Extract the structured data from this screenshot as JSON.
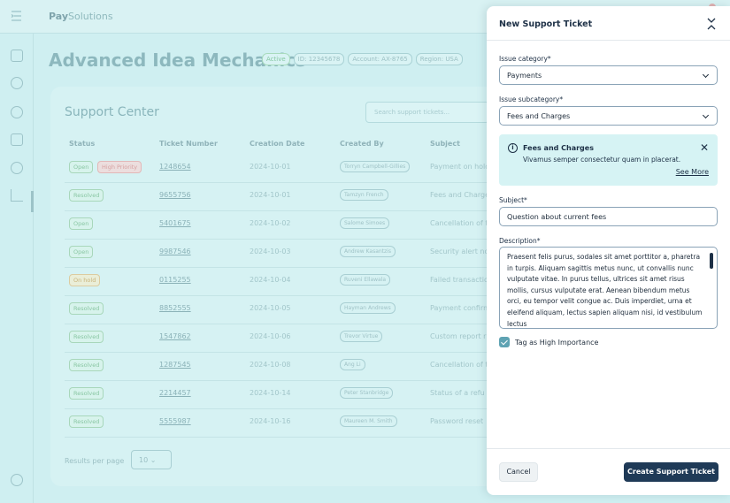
{
  "app": {
    "brand_bold": "Pay",
    "brand_rest": "Solutions",
    "org_title": "Advanced Idea Mechanics",
    "tags": [
      "Active",
      "ID: 12345678",
      "Account: AX-8765",
      "Region: USA"
    ]
  },
  "support": {
    "title": "Support Center",
    "search_placeholder": "Search support tickets...",
    "columns": [
      "Status",
      "Ticket Number",
      "Creation Date",
      "Created By",
      "Subject"
    ],
    "rows": [
      {
        "status": "Open",
        "priority": "High Priority",
        "ticket": "1248654",
        "date": "2024-10-01",
        "by": "Torryn Campbell-Gillies",
        "subject": "Payment on hold"
      },
      {
        "status": "Resolved",
        "priority": "",
        "ticket": "9655756",
        "date": "2024-10-01",
        "by": "Tamzyn French",
        "subject": "Fees and Charges"
      },
      {
        "status": "Open",
        "priority": "",
        "ticket": "5401675",
        "date": "2024-10-02",
        "by": "Salome Simoes",
        "subject": "Cancellation of t"
      },
      {
        "status": "Open",
        "priority": "",
        "ticket": "9987546",
        "date": "2024-10-03",
        "by": "Andrew Kasantzis",
        "subject": "Security alert no"
      },
      {
        "status": "On hold",
        "priority": "",
        "ticket": "0115255",
        "date": "2024-10-04",
        "by": "Ruveni Ellawala",
        "subject": "Failed transactio"
      },
      {
        "status": "Resolved",
        "priority": "",
        "ticket": "8852555",
        "date": "2024-10-05",
        "by": "Hayman Andrews",
        "subject": "Payment confirm"
      },
      {
        "status": "Resolved",
        "priority": "",
        "ticket": "1547862",
        "date": "2024-10-06",
        "by": "Trevor Virtue",
        "subject": "Custom report r"
      },
      {
        "status": "Resolved",
        "priority": "",
        "ticket": "1287545",
        "date": "2024-10-08",
        "by": "Ang Li",
        "subject": "Cancellation of t"
      },
      {
        "status": "Resolved",
        "priority": "",
        "ticket": "2214457",
        "date": "2024-10-14",
        "by": "Peter Stanbridge",
        "subject": "Status of a refu"
      },
      {
        "status": "Resolved",
        "priority": "",
        "ticket": "5555987",
        "date": "2024-10-16",
        "by": "Maureen M. Smith",
        "subject": "Password reset"
      }
    ],
    "results_label": "Results per page",
    "results_value": "10"
  },
  "drawer": {
    "title": "New Support Ticket",
    "category_label": "Issue category*",
    "category_value": "Payments",
    "subcategory_label": "Issue subcategory*",
    "subcategory_value": "Fees and Charges",
    "info_title": "Fees and Charges",
    "info_text": "Vivamus semper consectetur quam in placerat.",
    "info_link": "See More",
    "subject_label": "Subject*",
    "subject_value": "Question about current fees",
    "description_label": "Description*",
    "description_value": "Praesent felis purus, sodales sit amet porttitor a, pharetra in turpis. Aliquam sagittis metus nunc, ut convallis nunc vulputate vitae. In purus tellus, ultrices sit amet risus mollis, cursus vulputate erat. Aenean bibendum metus orci, eu tempor velit congue ac. Duis imperdiet, urna et eleifend aliquam, lectus sapien aliquam nisi, id vestibulum lectus",
    "checkbox_label": "Tag as High Importance",
    "checkbox_checked": true,
    "cancel_label": "Cancel",
    "create_label": "Create Support Ticket"
  }
}
